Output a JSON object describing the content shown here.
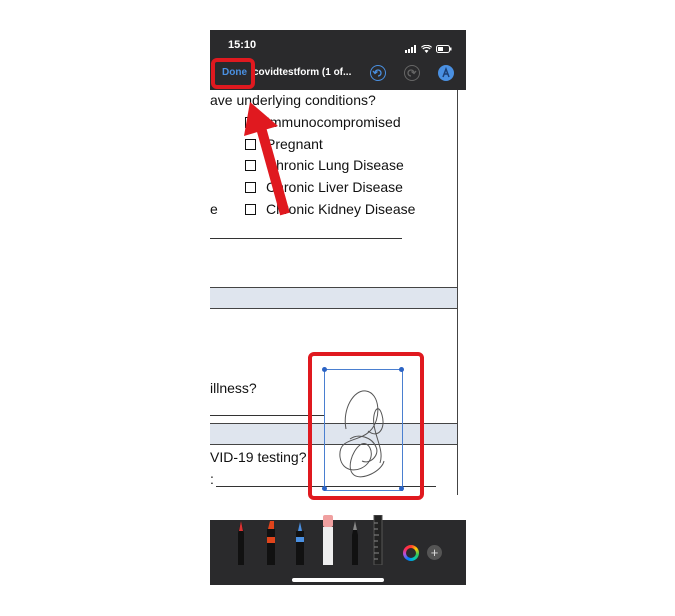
{
  "status_bar": {
    "time": "15:10"
  },
  "nav": {
    "done_label": "Done",
    "title": "covidtestform (1 of..."
  },
  "document": {
    "question_conditions": "ave underlying conditions?",
    "conditions": [
      "Immunocompromised",
      "Pregnant",
      "Chronic Lung Disease",
      "Chronic Liver Disease",
      "Chronic Kidney Disease"
    ],
    "left_fragment_e": "e",
    "question_illness": "illness?",
    "question_testing": "VID-19 testing?",
    "colon_fragment": ":"
  },
  "toolbar": {
    "tools": [
      "pen",
      "marker",
      "highlighter",
      "eraser",
      "pencil",
      "ruler"
    ],
    "add_label": "+"
  },
  "colors": {
    "annotation_red": "#e0191f",
    "ios_blue": "#4a90e2",
    "selection_blue": "#2b63c4",
    "table_band": "#dfe5ee"
  }
}
